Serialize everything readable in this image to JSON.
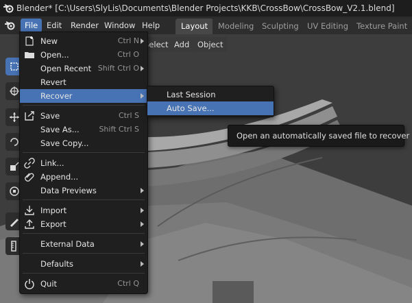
{
  "window": {
    "title": "Blender* [C:\\Users\\SlyLis\\Documents\\Blender Projects\\KKB\\CrossBow\\CrossBow_V2.1.blend]"
  },
  "menubar": {
    "items": [
      {
        "label": "File",
        "active": true
      },
      {
        "label": "Edit"
      },
      {
        "label": "Render"
      },
      {
        "label": "Window"
      },
      {
        "label": "Help"
      }
    ]
  },
  "workspaces": {
    "tabs": [
      {
        "label": "Layout",
        "active": true
      },
      {
        "label": "Modeling"
      },
      {
        "label": "Sculpting"
      },
      {
        "label": "UV Editing"
      },
      {
        "label": "Texture Paint"
      }
    ]
  },
  "viewport_header": {
    "items": [
      "Select",
      "Add",
      "Object"
    ]
  },
  "file_menu": {
    "items": [
      {
        "label": "New",
        "shortcut": "Ctrl N",
        "submenu": true,
        "icon": "new-file-icon"
      },
      {
        "label": "Open...",
        "shortcut": "Ctrl O",
        "icon": "folder-icon"
      },
      {
        "label": "Open Recent",
        "shortcut": "Shift Ctrl O",
        "submenu": true
      },
      {
        "label": "Revert"
      },
      {
        "label": "Recover",
        "submenu": true,
        "highlighted": true
      },
      {
        "label": "Save",
        "shortcut": "Ctrl S",
        "icon": "save-icon"
      },
      {
        "label": "Save As...",
        "shortcut": "Shift Ctrl S"
      },
      {
        "label": "Save Copy..."
      },
      {
        "label": "Link...",
        "icon": "link-icon"
      },
      {
        "label": "Append...",
        "icon": "append-icon"
      },
      {
        "label": "Data Previews",
        "submenu": true
      },
      {
        "label": "Import",
        "submenu": true,
        "icon": "import-icon"
      },
      {
        "label": "Export",
        "submenu": true,
        "icon": "export-icon"
      },
      {
        "label": "External Data",
        "submenu": true
      },
      {
        "label": "Defaults",
        "submenu": true
      },
      {
        "label": "Quit",
        "shortcut": "Ctrl Q",
        "icon": "power-icon"
      }
    ]
  },
  "recover_submenu": {
    "items": [
      {
        "label": "Last Session"
      },
      {
        "label": "Auto Save...",
        "highlighted": true
      }
    ]
  },
  "tooltip": {
    "text": "Open an automatically saved file to recover it."
  },
  "colors": {
    "accent": "#4772b3",
    "menu_bg": "#1f1f1f",
    "topbar_bg": "#2b2b2b"
  }
}
